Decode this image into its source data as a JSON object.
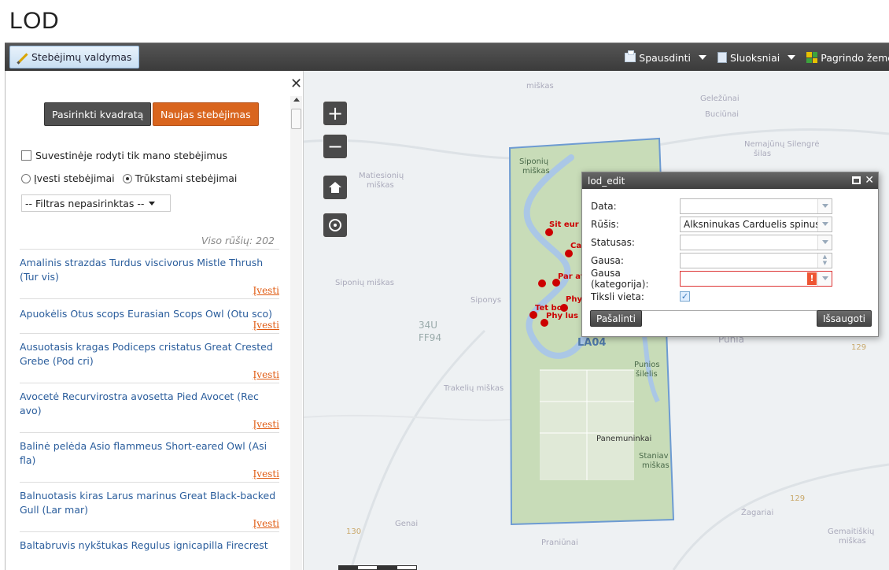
{
  "app": {
    "title": "LOD"
  },
  "toolbar": {
    "left_button": "Stebėjimų valdymas",
    "print": "Spausdinti",
    "layers": "Sluoksniai",
    "base": "Pagrindo žemė"
  },
  "sidebar": {
    "buttons": {
      "choose_square": "Pasirinkti kvadratą",
      "new_observation": "Naujas stebėjimas"
    },
    "checkbox_only_mine": "Suvestinėje rodyti tik mano stebėjimus",
    "radio_entered": "Įvesti stebėjimai",
    "radio_missing": "Trūkstami stebėjimai",
    "filter_select": "-- Filtras nepasirinktas --",
    "species_count": "Viso rūšių: 202",
    "species": [
      {
        "name": "Amalinis strazdas Turdus viscivorus Mistle Thrush (Tur vis)",
        "link": "Įvesti"
      },
      {
        "name": "Apuokėlis Otus scops Eurasian Scops Owl (Otu sco)",
        "link": "Įvesti"
      },
      {
        "name": "Ausuotasis kragas Podiceps cristatus Great Crested Grebe (Pod cri)",
        "link": "Įvesti"
      },
      {
        "name": "Avocetė Recurvirostra avosetta Pied Avocet (Rec avo)",
        "link": "Įvesti"
      },
      {
        "name": "Balinė pelėda Asio flammeus Short-eared Owl (Asi fla)",
        "link": "Įvesti"
      },
      {
        "name": "Balnuotasis kiras Larus marinus Great Black-backed Gull (Lar mar)",
        "link": "Įvesti"
      },
      {
        "name": "Baltabruvis nykštukas Regulus ignicapilla Firecrest",
        "link": ""
      }
    ]
  },
  "map": {
    "labels": {
      "miskas_top": "miškas",
      "gelezunai": "Geležūnai",
      "buciunai": "Buciūnai",
      "nemajunu": "Nemajūnų Silengrė",
      "silas": "šilas",
      "siponiu": "Siponių",
      "siponiu_miskas": "miškas",
      "matiesioniu": "Matiesionių",
      "matiesioniu_miskas": "miškas",
      "siponiu_left": "Siponių miškas",
      "siponys": "Siponys",
      "grid_34u": "34U",
      "grid_ff94": "FF94",
      "la04": "LA04",
      "punia": "Punia",
      "punios": "Punios",
      "silelis": "šilelis",
      "trakeliu": "Trakelių miškas",
      "panemuninkai": "Panemuninkai",
      "staniav": "Staniav",
      "staniav_miskas": "miškas",
      "zagariai": "Žagariai",
      "genai": "Genai",
      "praniunai": "Praniūnai",
      "gemaitiskiu": "Gemaitiškių",
      "gemaitiskiu_miskas": "miškas",
      "road_129": "129",
      "road_129b": "129",
      "road_130": "130"
    },
    "observations": [
      "Sit eur",
      "Ca",
      "Par at",
      "Phy",
      "Tet bon",
      "Phy lus"
    ]
  },
  "dialog": {
    "title": "lod_edit",
    "fields": {
      "data": "Data:",
      "rusis": "Rūšis:",
      "rusis_value": "Alksninukas Carduelis spinus I",
      "statusas": "Statusas:",
      "gausa": "Gausa:",
      "gausa_kat": "Gausa (kategorija):",
      "tikslivieta": "Tiksli vieta:"
    },
    "buttons": {
      "remove": "Pašalinti",
      "save": "Išsaugoti"
    }
  },
  "colors": {
    "accent_orange": "#d9651e",
    "link_blue": "#2a5d9c",
    "area_green": "#c8dcb8",
    "marker_red": "#cc0000"
  }
}
